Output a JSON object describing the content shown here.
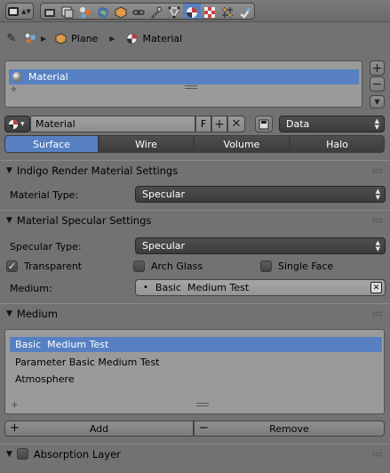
{
  "toolbar": {
    "icons": [
      "editor-type-icon",
      "render-icon",
      "render-layers-icon",
      "scene-icon",
      "world-icon",
      "object-icon",
      "constraints-icon",
      "modifiers-icon",
      "object-data-icon",
      "material-icon",
      "texture-icon",
      "particles-icon",
      "physics-icon"
    ]
  },
  "breadcrumb": {
    "object": "Plane",
    "material": "Material"
  },
  "material_slots": {
    "items": [
      "Material"
    ]
  },
  "datablock": {
    "name": "Material",
    "fake_user": "F",
    "link": "Data"
  },
  "preview_tabs": [
    "Surface",
    "Wire",
    "Volume",
    "Halo"
  ],
  "indigo_panel": {
    "title": "Indigo Render Material Settings",
    "material_type_label": "Material Type:",
    "material_type_value": "Specular"
  },
  "specular_panel": {
    "title": "Material Specular Settings",
    "specular_type_label": "Specular Type:",
    "specular_type_value": "Specular",
    "transparent_label": "Transparent",
    "transparent_checked": true,
    "arch_glass_label": "Arch Glass",
    "arch_glass_checked": false,
    "single_face_label": "Single Face",
    "single_face_checked": false,
    "medium_label": "Medium:",
    "medium_value": "Basic  Medium Test"
  },
  "medium_panel": {
    "title": "Medium",
    "items": [
      "Basic  Medium Test",
      "Parameter Basic Medium Test",
      "Atmosphere"
    ],
    "add_label": "Add",
    "remove_label": "Remove"
  },
  "absorption_panel": {
    "title": "Absorption Layer"
  },
  "colors": {
    "selection": "#5680c2",
    "panel_bg": "#727272",
    "dropdown_bg": "#444444"
  }
}
